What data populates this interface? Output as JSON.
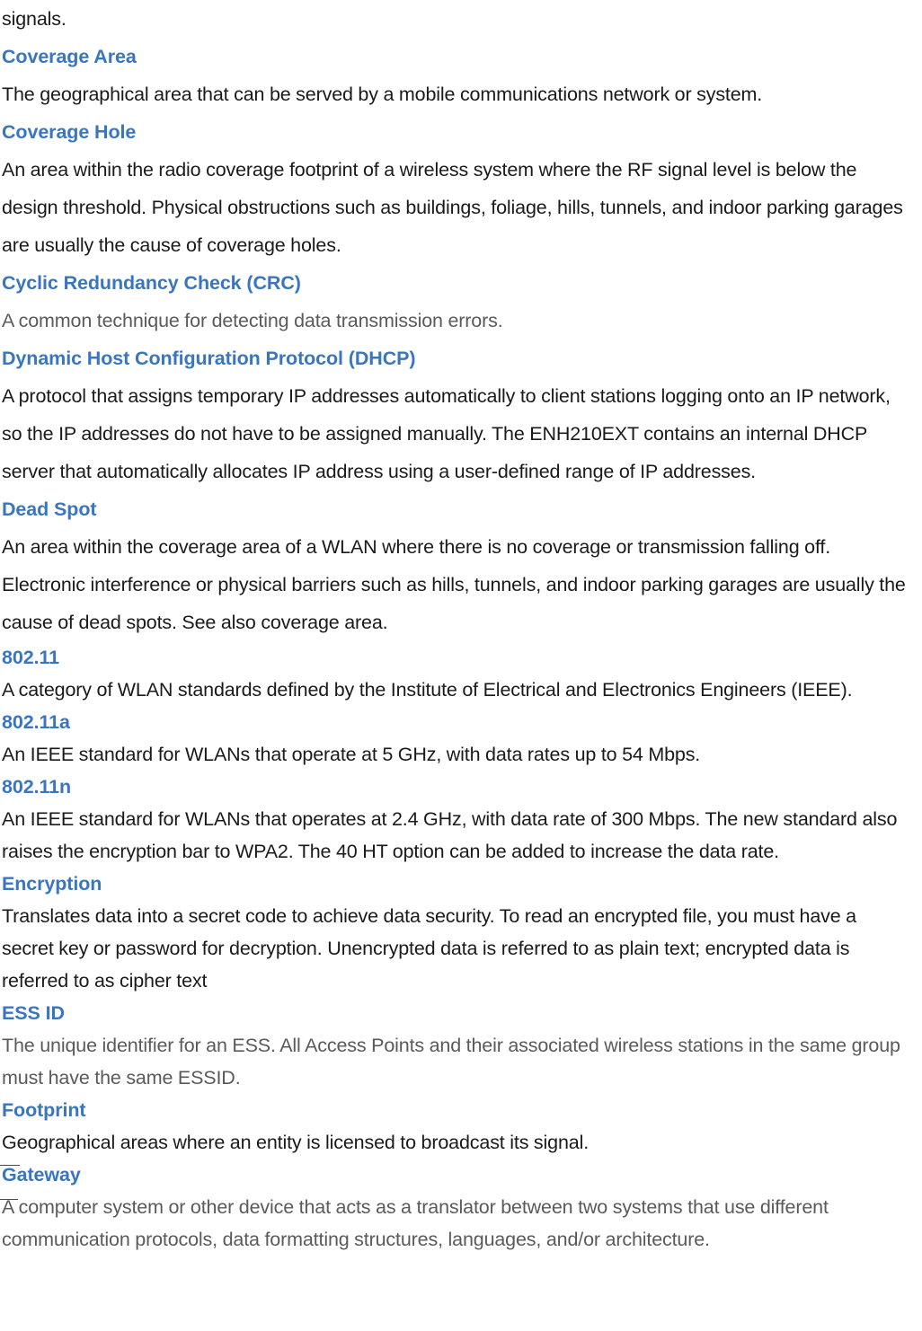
{
  "document": {
    "type": "glossary-page",
    "continuation_text": "signals.",
    "colors": {
      "heading": "#3a76be",
      "body": "#1a1a1a",
      "body_muted": "#5a5a5a",
      "background": "#ffffff"
    }
  },
  "entries": [
    {
      "term": "Coverage Area",
      "definition": "The geographical area that can be served by a mobile communications network or system.",
      "muted": false
    },
    {
      "term": "Coverage Hole",
      "definition": "An area within the radio coverage footprint of a wireless system where the RF signal level is below the design threshold. Physical obstructions such as buildings, foliage, hills, tunnels, and indoor parking garages are usually the cause of coverage holes.",
      "muted": false
    },
    {
      "term": "Cyclic Redundancy Check (CRC)",
      "definition": "A common technique for detecting data transmission errors.",
      "muted": true
    },
    {
      "term": "Dynamic Host Configuration Protocol (DHCP)",
      "definition": "A protocol that assigns temporary IP addresses automatically to client stations logging onto an IP network, so the IP addresses do not have to be assigned manually. The ENH210EXT contains an internal DHCP server that automatically allocates IP address using a user-defined range of IP addresses.",
      "muted": false
    },
    {
      "term": "Dead Spot",
      "definition": "An area within the coverage area of a WLAN where there is no coverage or transmission falling off. Electronic interference or physical barriers such as hills, tunnels, and indoor parking garages are usually the cause of dead spots. See also coverage area.",
      "muted": false
    },
    {
      "term": "802.11",
      "definition": "A category of WLAN standards defined by the Institute of Electrical and Electronics Engineers (IEEE).",
      "muted": false
    },
    {
      "term": "802.11a",
      "definition": "An IEEE standard for WLANs that operate at 5 GHz, with data rates up to 54 Mbps.",
      "muted": false
    },
    {
      "term": "802.11n",
      "definition": "An IEEE standard for WLANs that operates at 2.4 GHz, with data rate of 300 Mbps. The new standard also raises the encryption bar to WPA2. The 40 HT option can be added to increase the data rate.",
      "muted": false
    },
    {
      "term": "Encryption",
      "definition": "Translates data into a secret code to achieve data security. To read an encrypted file, you must have a secret key or password for decryption. Unencrypted data is referred to as plain text; encrypted data is referred to as cipher text",
      "muted": false
    },
    {
      "term": "ESS ID",
      "definition": "The unique identifier for an ESS. All Access Points and their associated wireless stations in the same group must have the same ESSID.",
      "muted": true
    },
    {
      "term": "Footprint",
      "definition": "Geographical areas where an entity is licensed to broadcast its signal.",
      "muted": false
    },
    {
      "term": "Gateway",
      "definition": "A computer system or other device that acts as a translator between two systems that use different communication protocols, data formatting structures, languages, and/or architecture.",
      "muted": true
    }
  ]
}
